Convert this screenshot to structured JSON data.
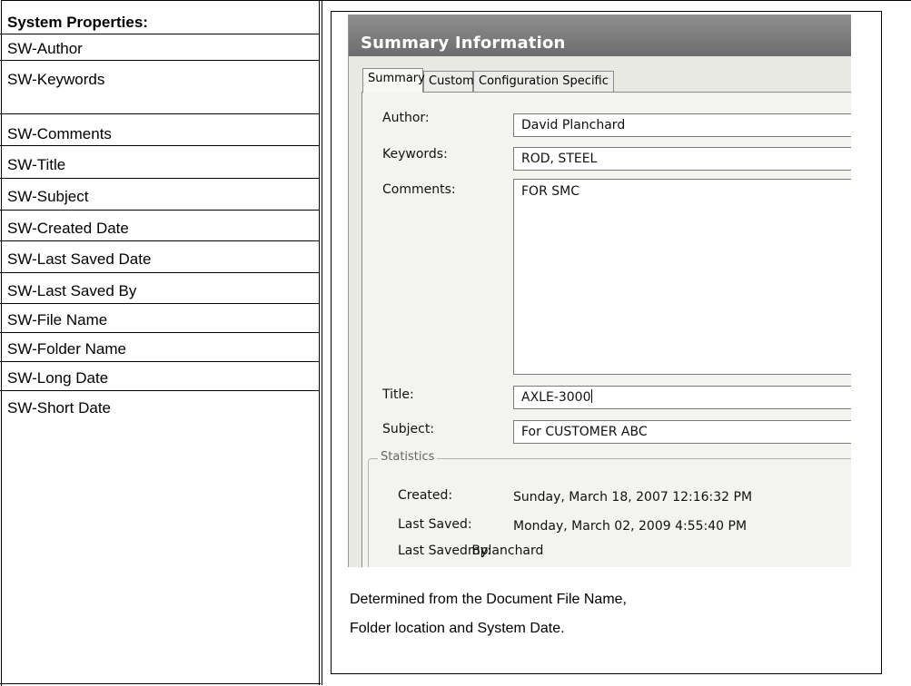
{
  "left_column": {
    "header": "System Properties:",
    "items": [
      "SW-Author",
      "SW-Keywords",
      "SW-Comments",
      "SW-Title",
      "SW-Subject",
      "SW-Created Date",
      "SW-Last Saved Date",
      "SW-Last Saved By",
      "SW-File Name",
      "SW-Folder Name",
      "SW-Long Date",
      "SW-Short Date"
    ]
  },
  "dialog": {
    "title": "Summary Information",
    "tabs": [
      "Summary",
      "Custom",
      "Configuration Specific"
    ],
    "active_tab": "Summary",
    "fields": {
      "author_label": "Author:",
      "author_value": "David Planchard",
      "keywords_label": "Keywords:",
      "keywords_value": "ROD, STEEL",
      "comments_label": "Comments:",
      "comments_value": "FOR SMC",
      "title_label": "Title:",
      "title_value": "AXLE-3000",
      "subject_label": "Subject:",
      "subject_value": "For CUSTOMER ABC"
    },
    "statistics": {
      "legend": "Statistics",
      "created_label": "Created:",
      "created_value": "Sunday, March 18, 2007 12:16:32 PM",
      "last_saved_label": "Last Saved:",
      "last_saved_value": "Monday, March 02, 2009 4:55:40 PM",
      "last_saved_by_label": "Last Saved By:",
      "last_saved_by_value": "mplanchard"
    }
  },
  "caption": {
    "line1": "Determined from the Document File Name,",
    "line2": "Folder location and System Date."
  }
}
